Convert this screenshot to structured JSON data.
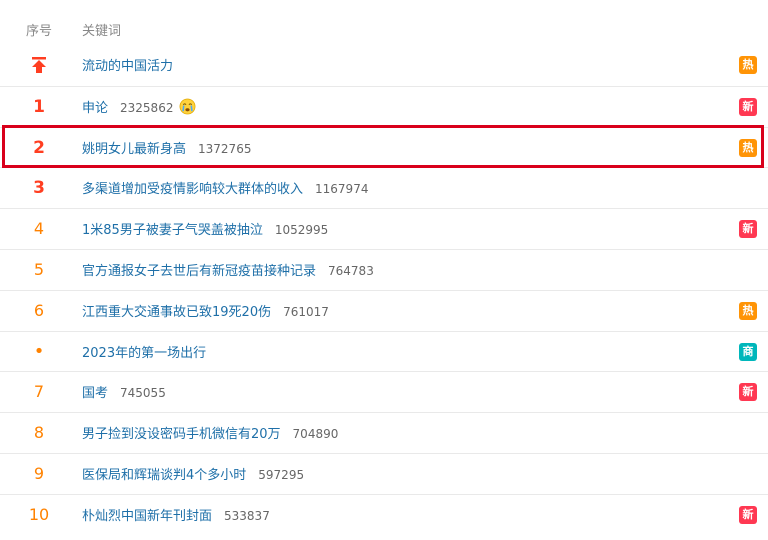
{
  "header": {
    "rank_label": "序号",
    "keyword_label": "关键词"
  },
  "colors": {
    "hot": "#ff9406",
    "new": "#ff3852",
    "ad": "#00b7bb",
    "rank": "#ff8200",
    "top_rank": "#ff3e21",
    "keyword": "#1e6fa8"
  },
  "rows": [
    {
      "rank": "",
      "keyword": "流动的中国活力",
      "count": "",
      "badge": "热",
      "badge_type": "hot",
      "icon": "pin-top-icon"
    },
    {
      "rank": "1",
      "keyword": "申论",
      "count": "2325862",
      "badge": "新",
      "badge_type": "new",
      "icon": "crying-face-emoji"
    },
    {
      "rank": "2",
      "keyword": "姚明女儿最新身高",
      "count": "1372765",
      "badge": "热",
      "badge_type": "hot",
      "highlighted": true
    },
    {
      "rank": "3",
      "keyword": "多渠道增加受疫情影响较大群体的收入",
      "count": "1167974",
      "badge": "",
      "badge_type": ""
    },
    {
      "rank": "4",
      "keyword": "1米85男子被妻子气哭盖被抽泣",
      "count": "1052995",
      "badge": "新",
      "badge_type": "new"
    },
    {
      "rank": "5",
      "keyword": "官方通报女子去世后有新冠疫苗接种记录",
      "count": "764783",
      "badge": "",
      "badge_type": ""
    },
    {
      "rank": "6",
      "keyword": "江西重大交通事故已致19死20伤",
      "count": "761017",
      "badge": "热",
      "badge_type": "hot"
    },
    {
      "rank": "•",
      "keyword": "2023年的第一场出行",
      "count": "",
      "badge": "商",
      "badge_type": "ad"
    },
    {
      "rank": "7",
      "keyword": "国考",
      "count": "745055",
      "badge": "新",
      "badge_type": "new"
    },
    {
      "rank": "8",
      "keyword": "男子捡到没设密码手机微信有20万",
      "count": "704890",
      "badge": "",
      "badge_type": ""
    },
    {
      "rank": "9",
      "keyword": "医保局和辉瑞谈判4个多小时",
      "count": "597295",
      "badge": "",
      "badge_type": ""
    },
    {
      "rank": "10",
      "keyword": "朴灿烈中国新年刊封面",
      "count": "533837",
      "badge": "新",
      "badge_type": "new"
    }
  ]
}
